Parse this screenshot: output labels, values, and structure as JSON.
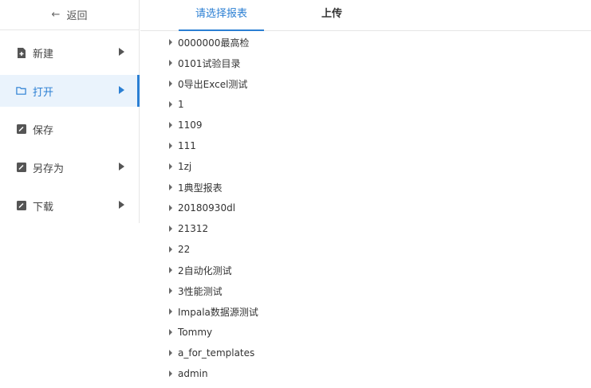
{
  "sidebar": {
    "back_label": "返回",
    "items": [
      {
        "label": "新建",
        "icon": "file-add-icon",
        "has_submenu": true,
        "active": false
      },
      {
        "label": "打开",
        "icon": "folder-icon",
        "has_submenu": true,
        "active": true
      },
      {
        "label": "保存",
        "icon": "save-icon",
        "has_submenu": false,
        "active": false
      },
      {
        "label": "另存为",
        "icon": "save-as-icon",
        "has_submenu": true,
        "active": false
      },
      {
        "label": "下载",
        "icon": "download-icon",
        "has_submenu": true,
        "active": false
      }
    ]
  },
  "tabs": [
    {
      "label": "请选择报表",
      "active": true
    },
    {
      "label": "上传",
      "active": false
    }
  ],
  "tree": {
    "items": [
      "0000000最高检",
      "0101试验目录",
      "0导出Excel测试",
      "1",
      "1109",
      "111",
      "1zj",
      "1典型报表",
      "20180930dl",
      "21312",
      "22",
      "2自动化测试",
      "3性能测试",
      "Impala数据源测试",
      "Tommy",
      "a_for_templates",
      "admin"
    ]
  },
  "colors": {
    "accent": "#2b7fd3",
    "active_bg": "#eaf3fc",
    "border": "#e6e6e6"
  }
}
